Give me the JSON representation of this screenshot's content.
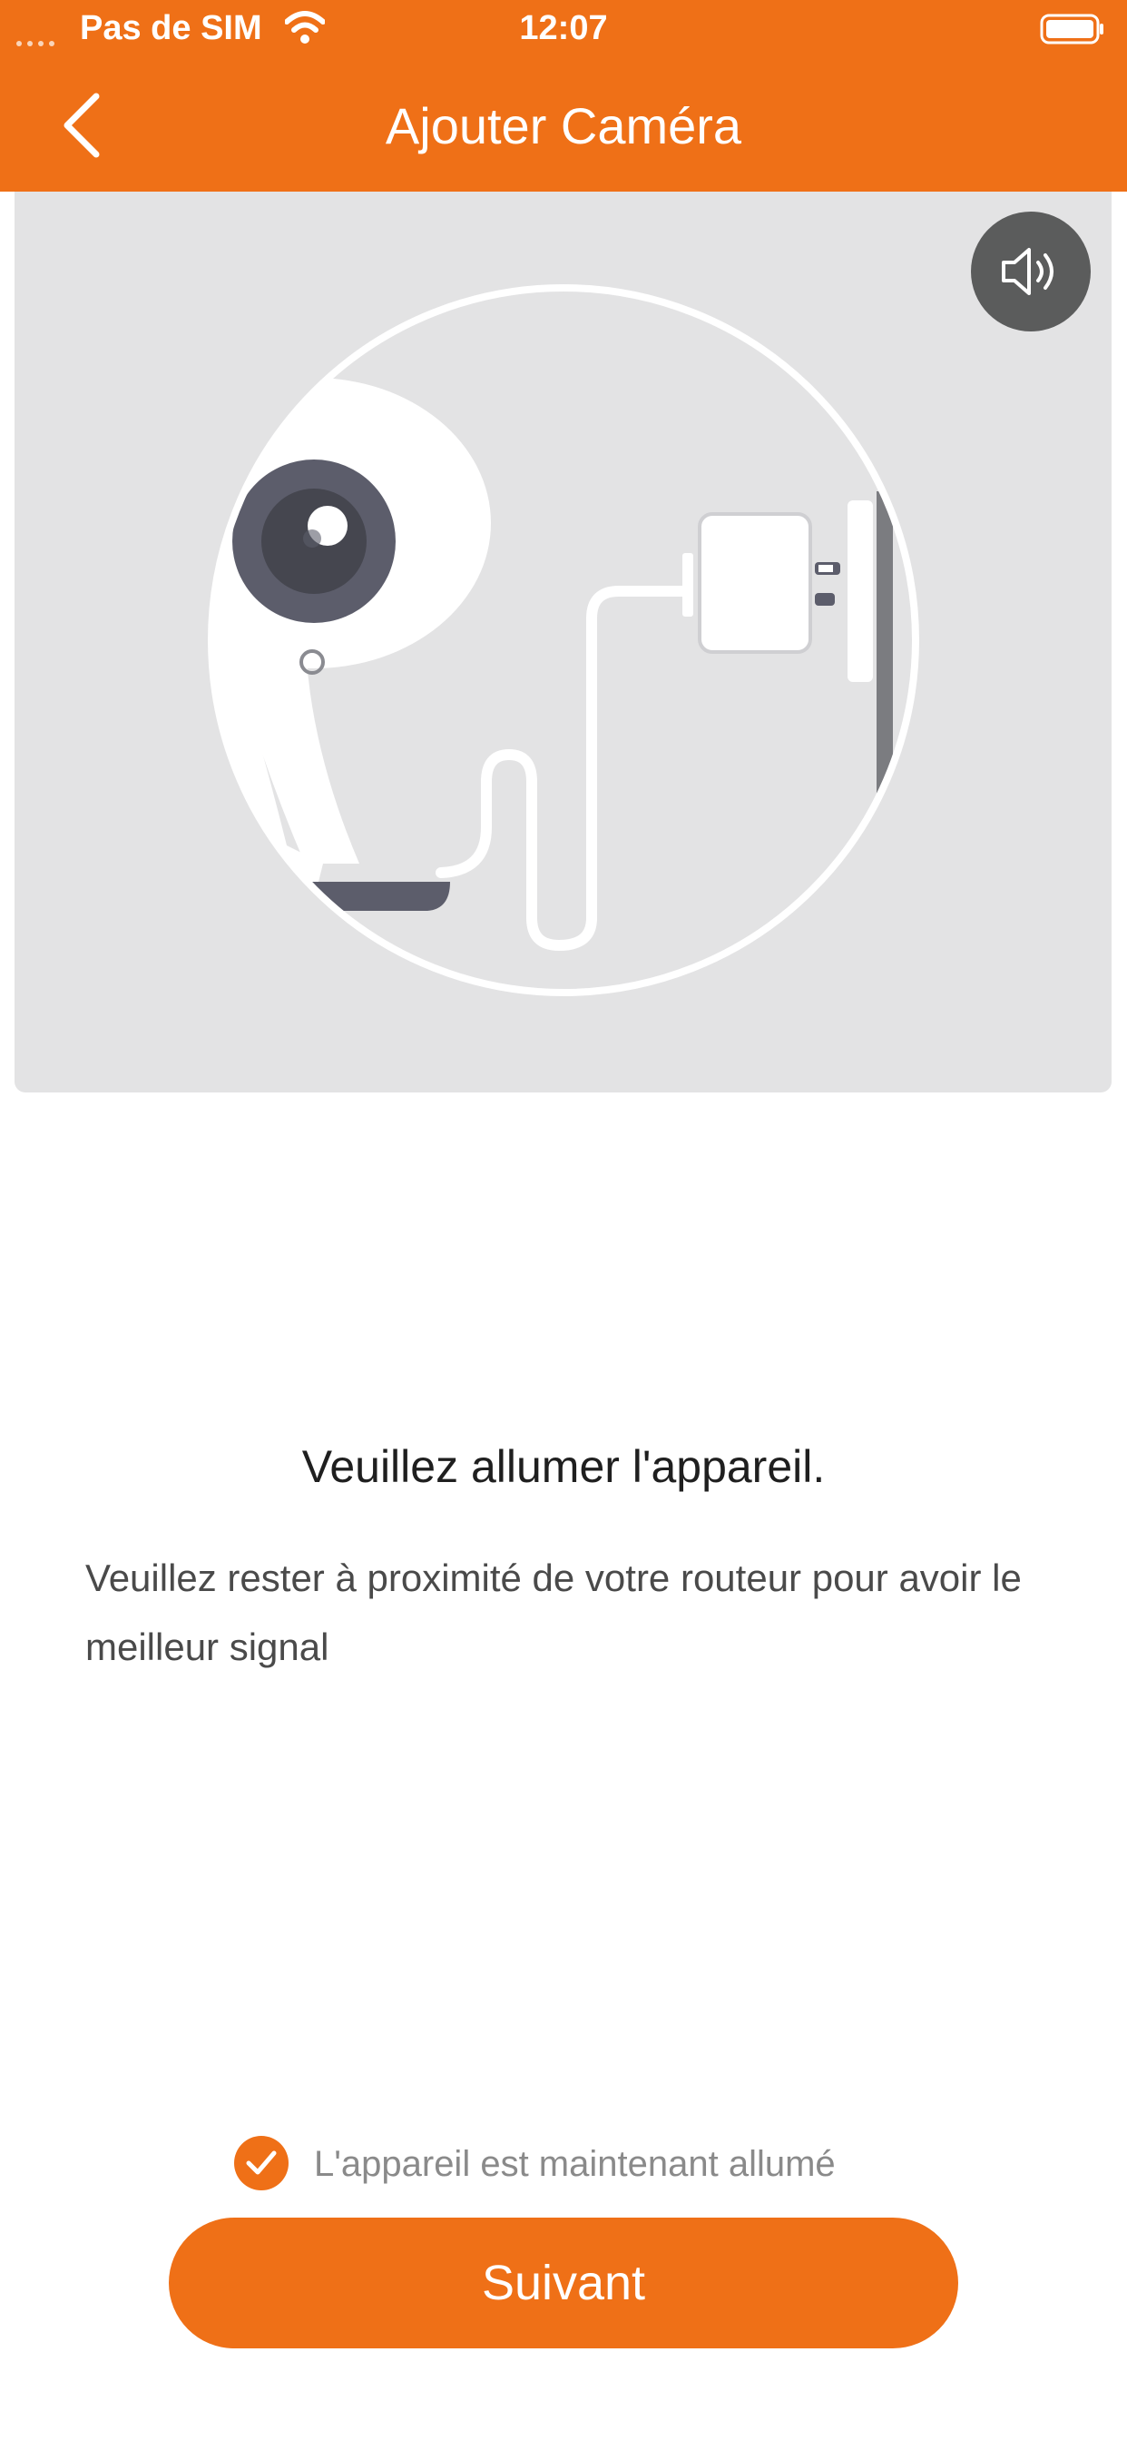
{
  "status_bar": {
    "carrier": "Pas de SIM",
    "time": "12:07",
    "wifi_icon": "wifi-icon",
    "battery_icon": "battery-icon"
  },
  "nav": {
    "title": "Ajouter Caméra",
    "back_icon": "chevron-left-icon"
  },
  "illustration": {
    "sound_icon": "speaker-icon"
  },
  "content": {
    "headline": "Veuillez allumer l'appareil.",
    "subtext": "Veuillez rester à proximité de votre routeur pour avoir le meilleur signal"
  },
  "confirm": {
    "label": "L'appareil est maintenant allumé",
    "checked": true
  },
  "next_button": {
    "label": "Suivant"
  },
  "colors": {
    "brand": "#EF7017",
    "panel": "#E3E3E4",
    "speaker_bg": "#5B5C5C"
  }
}
